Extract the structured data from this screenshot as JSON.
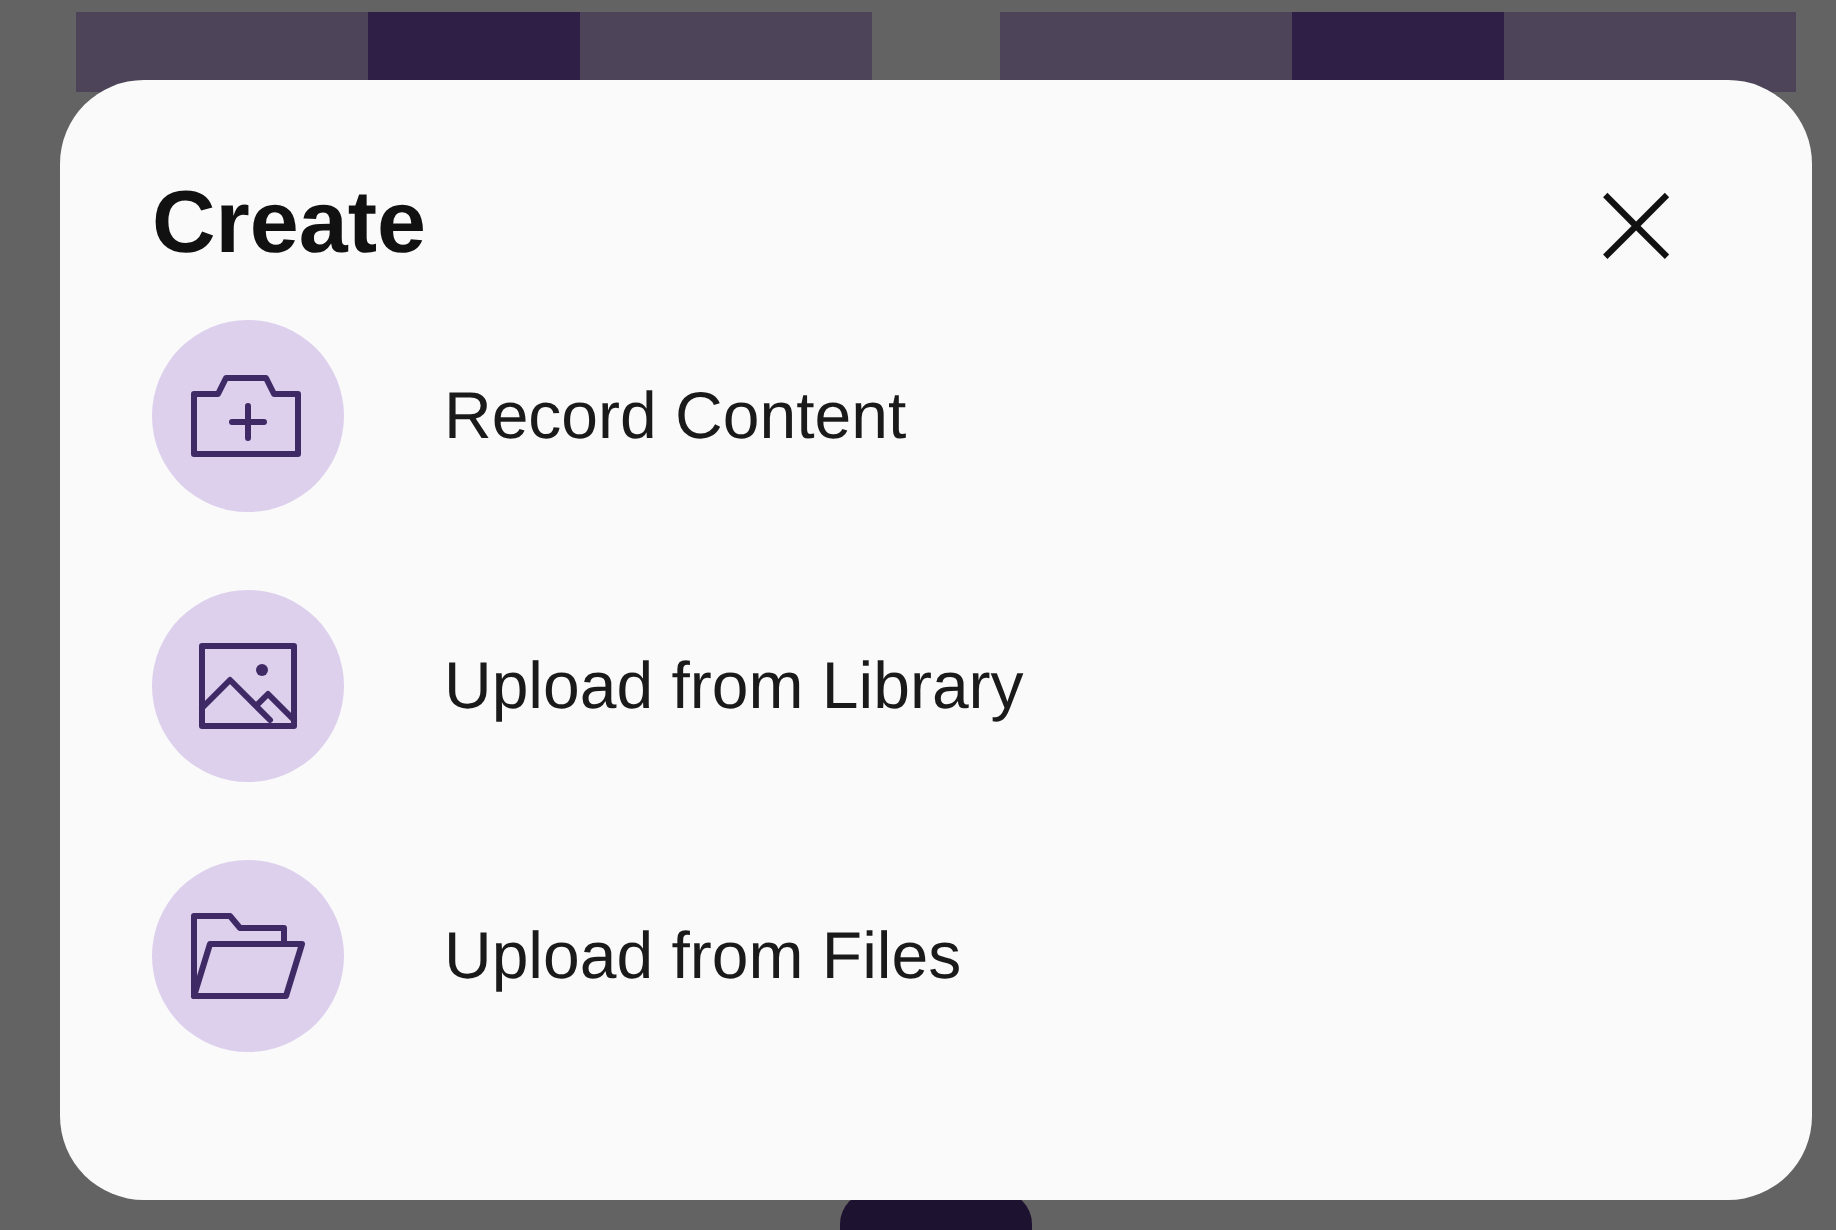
{
  "dialog": {
    "title": "Create",
    "close_label": "×"
  },
  "options": [
    {
      "kind": "camera",
      "label": "Record Content"
    },
    {
      "kind": "image",
      "label": "Upload from Library"
    },
    {
      "kind": "folder",
      "label": "Upload from Files"
    }
  ]
}
